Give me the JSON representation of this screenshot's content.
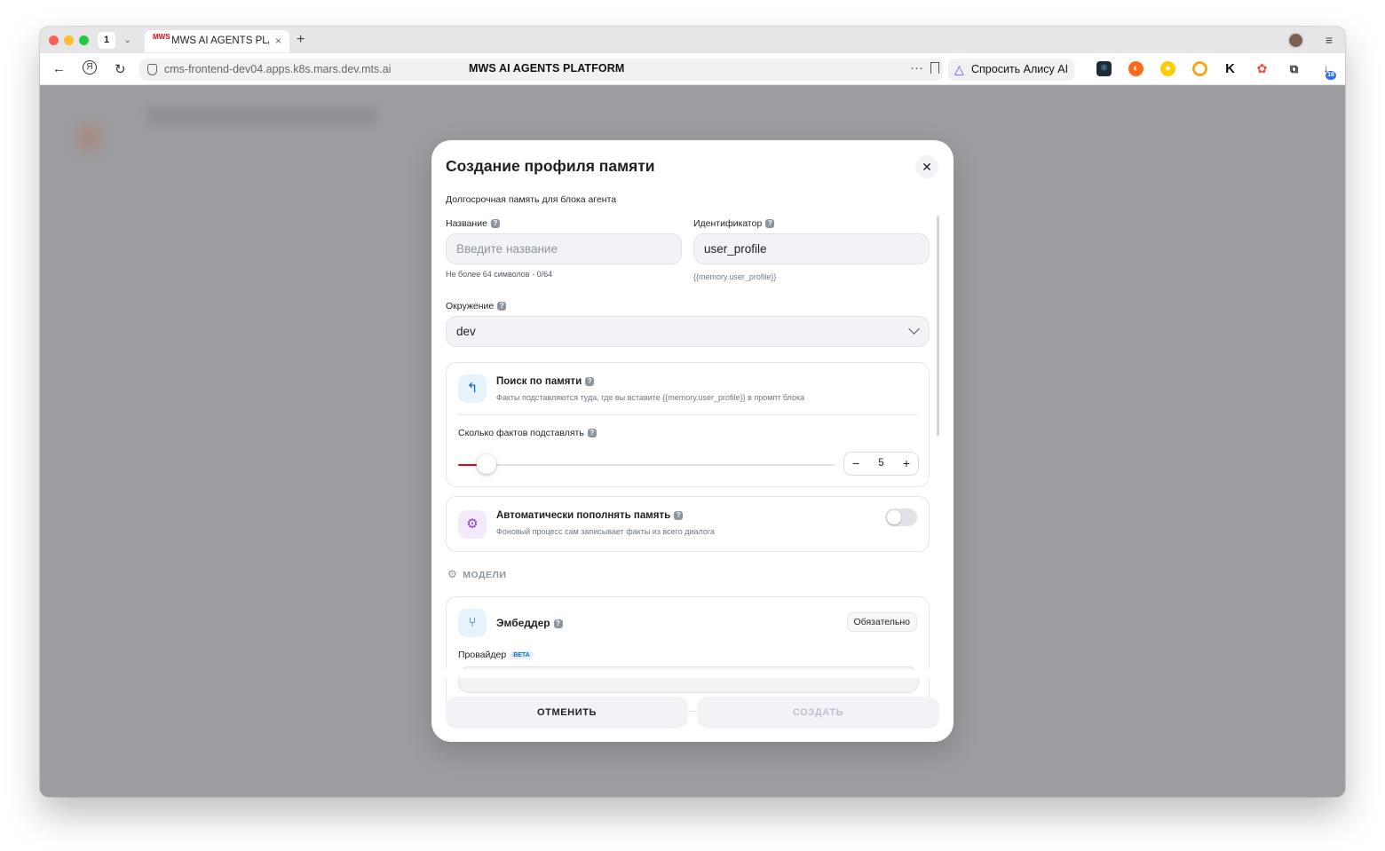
{
  "browser": {
    "tab_count": "1",
    "tab_title": "MWS AI AGENTS PLATFORM",
    "tab_favicon": "MWS",
    "url": "cms-frontend-dev04.apps.k8s.mars.dev.mts.ai",
    "page_title": "MWS AI AGENTS PLATFORM",
    "alice_button": "Спросить Алису AI",
    "extension_badge": "18"
  },
  "modal": {
    "title": "Создание профиля памяти",
    "subtitle": "Долгосрочная память для блока агента",
    "name": {
      "label": "Название",
      "placeholder": "Введите название",
      "hint": "Не более 64 символов · 0/64"
    },
    "identifier": {
      "label": "Идентификатор",
      "value": "user_profile",
      "hint": "{{memory.user_profile}}"
    },
    "environment": {
      "label": "Окружение",
      "value": "dev"
    },
    "memory_search": {
      "title": "Поиск по памяти",
      "description": "Факты подставляются туда, где вы вставите {{memory.user_profile}} в промпт блока",
      "facts_label": "Сколько фактов подставлять",
      "facts_value": "5",
      "facts_fraction": 0.05
    },
    "auto_fill": {
      "title": "Автоматически пополнять память",
      "description": "Фоновый процесс сам записывает факты из всего диалога",
      "enabled": false
    },
    "models_section": "МОДЕЛИ",
    "embedder": {
      "title": "Эмбеддер",
      "badge": "Обязательно",
      "provider_label": "Провайдер",
      "provider_tag": "BETA"
    },
    "cancel_button": "ОТМЕНИТЬ",
    "create_button": "СОЗДАТЬ"
  },
  "colors": {
    "accent": "#e30611",
    "text": "#1d2023",
    "muted": "#8d969f",
    "field_bg": "#f2f3f7"
  }
}
